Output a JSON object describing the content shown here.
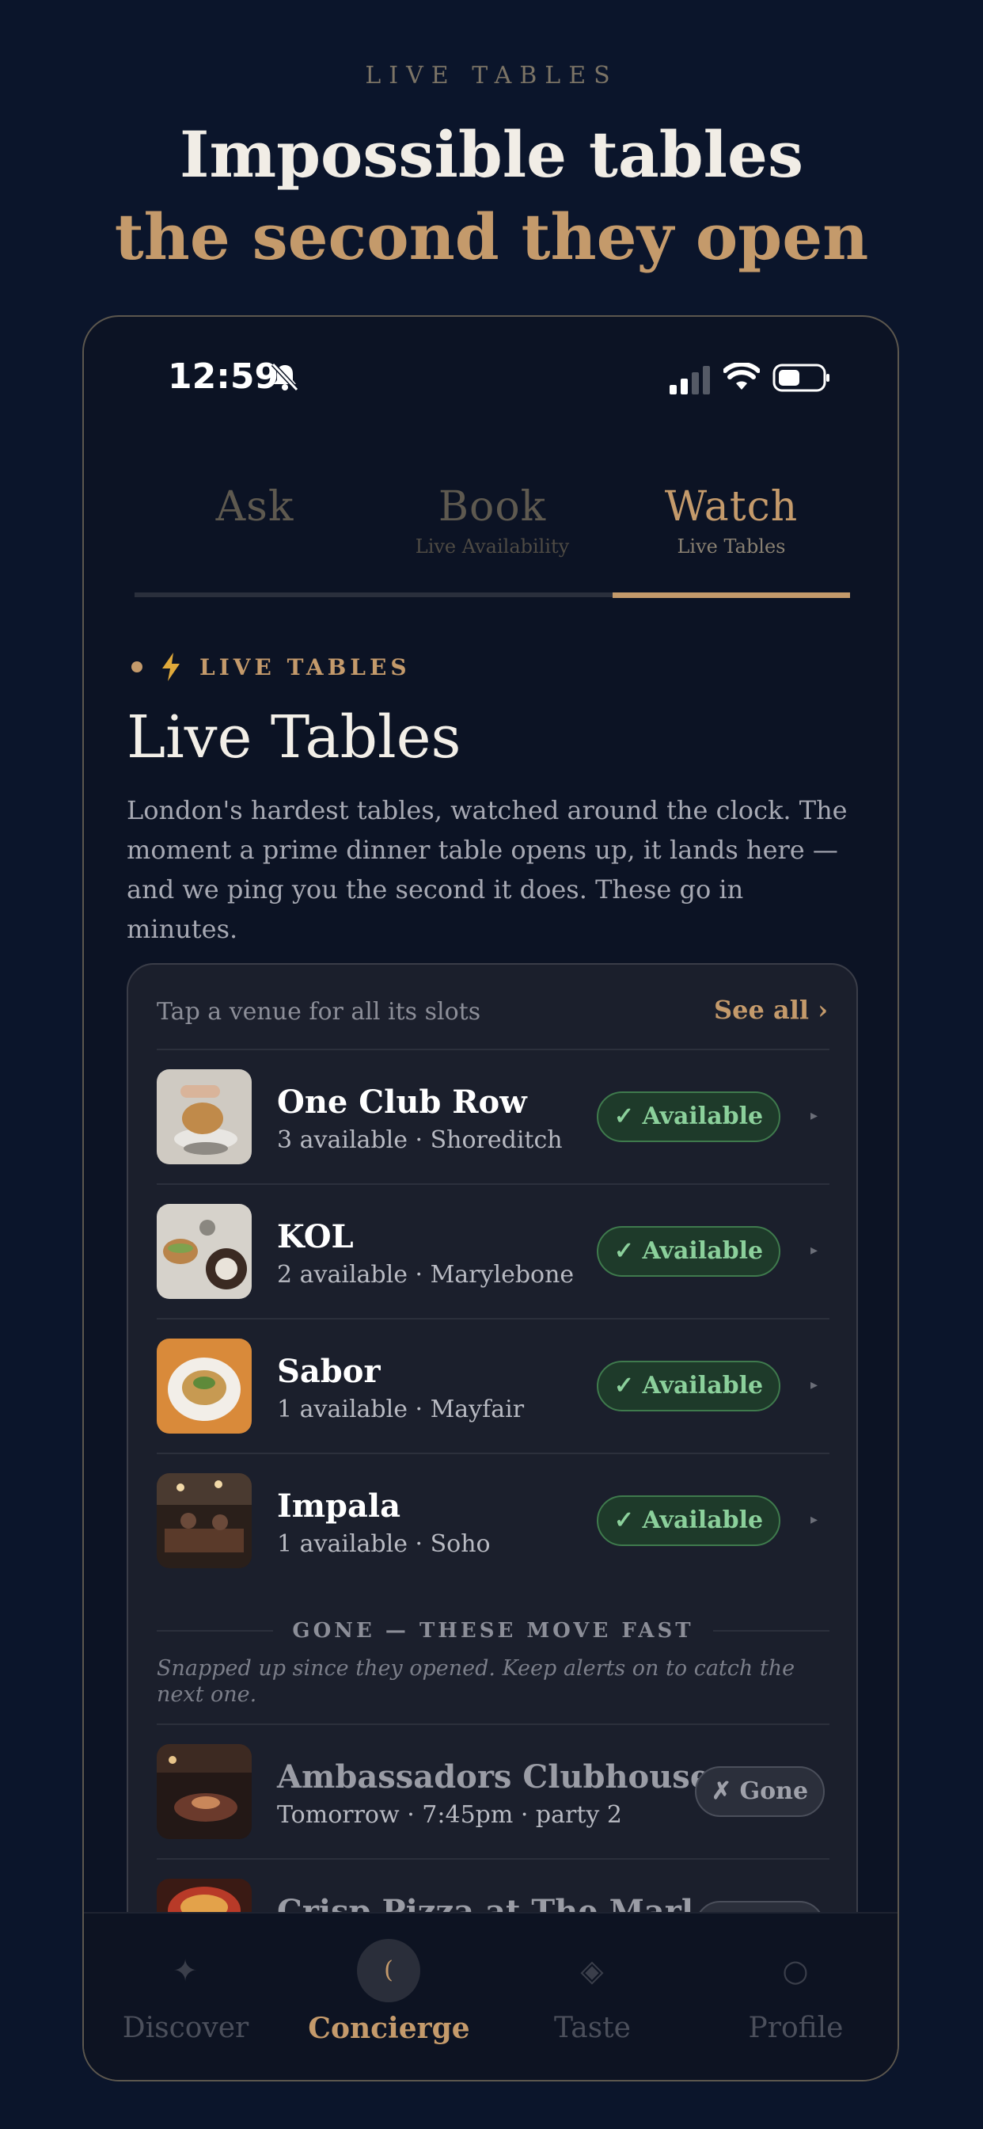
{
  "hero": {
    "eyebrow": "LIVE   TABLES",
    "line1": "Impossible tables",
    "line2": "the second they open"
  },
  "status_bar": {
    "time": "12:59",
    "icons": [
      "bell-slash-icon",
      "signal-icon",
      "wifi-icon",
      "battery-icon"
    ]
  },
  "tabs": [
    {
      "label": "Ask",
      "sub": ""
    },
    {
      "label": "Book",
      "sub": "Live Availability"
    },
    {
      "label": "Watch",
      "sub": "Live Tables",
      "active": true
    }
  ],
  "section": {
    "eyebrow": "LIVE TABLES",
    "title": "Live Tables",
    "description": "London's hardest tables, watched around the clock. The moment a prime dinner table opens up, it lands here — and we ping you the second it does. These go in minutes."
  },
  "card": {
    "hint": "Tap a venue for all its slots",
    "see_all": "See all ›",
    "available": [
      {
        "name": "One Club Row",
        "sub": "3 available · Shoreditch",
        "status": "✓ Available"
      },
      {
        "name": "KOL",
        "sub": "2 available · Marylebone",
        "status": "✓ Available"
      },
      {
        "name": "Sabor",
        "sub": "1 available · Mayfair",
        "status": "✓ Available"
      },
      {
        "name": "Impala",
        "sub": "1 available · Soho",
        "status": "✓ Available"
      }
    ],
    "gone_heading": "GONE — THESE MOVE FAST",
    "gone_note": "Snapped up since they opened. Keep alerts on to catch the next one.",
    "gone": [
      {
        "name": "Ambassadors Clubhouse",
        "sub": "Tomorrow · 7:45pm · party 2",
        "status": "✗ Gone"
      },
      {
        "name": "Crisp Pizza at The Marl",
        "sub": "",
        "status": ""
      }
    ]
  },
  "bottom_nav": [
    {
      "label": "Discover",
      "icon": "sparkle-icon"
    },
    {
      "label": "Concierge",
      "icon": "moon-icon",
      "active": true
    },
    {
      "label": "Taste",
      "icon": "diamond-icon"
    },
    {
      "label": "Profile",
      "icon": "circle-icon"
    }
  ],
  "colors": {
    "background": "#0b152b",
    "accent_gold": "#c49a6b",
    "available_green": "#8bd09b",
    "card": "#1b1f2c"
  }
}
